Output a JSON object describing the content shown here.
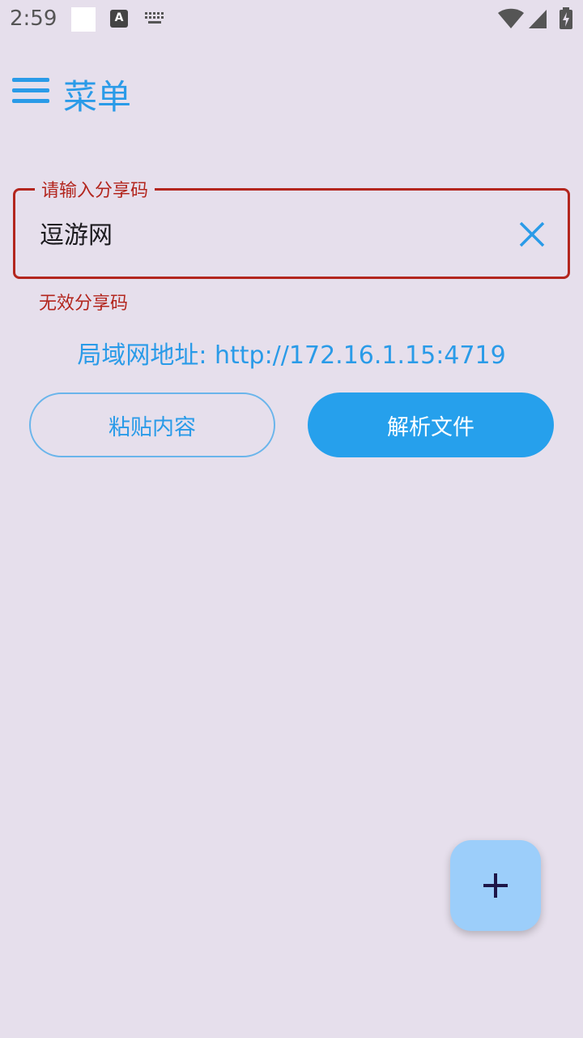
{
  "status_bar": {
    "time": "2:59",
    "icons": [
      "notification-square-icon",
      "a-icon",
      "keyboard-icon",
      "wifi-icon",
      "cell-signal-icon",
      "battery-charging-icon"
    ],
    "a_icon_glyph": "A"
  },
  "topbar": {
    "menu_icon": "hamburger-menu-icon",
    "title": "菜单"
  },
  "share_code": {
    "label": "请输入分享码",
    "value": "逗游网",
    "clear_icon": "close-icon",
    "error": "无效分享码"
  },
  "lan_address": "局域网地址: http://172.16.1.15:4719",
  "buttons": {
    "paste_label": "粘贴内容",
    "parse_label": "解析文件"
  },
  "fab": {
    "icon": "add-icon"
  },
  "colors": {
    "background": "#E6DFEC",
    "accent": "#2A9BE8",
    "error": "#B3261E",
    "fab": "#9CCEFA"
  }
}
